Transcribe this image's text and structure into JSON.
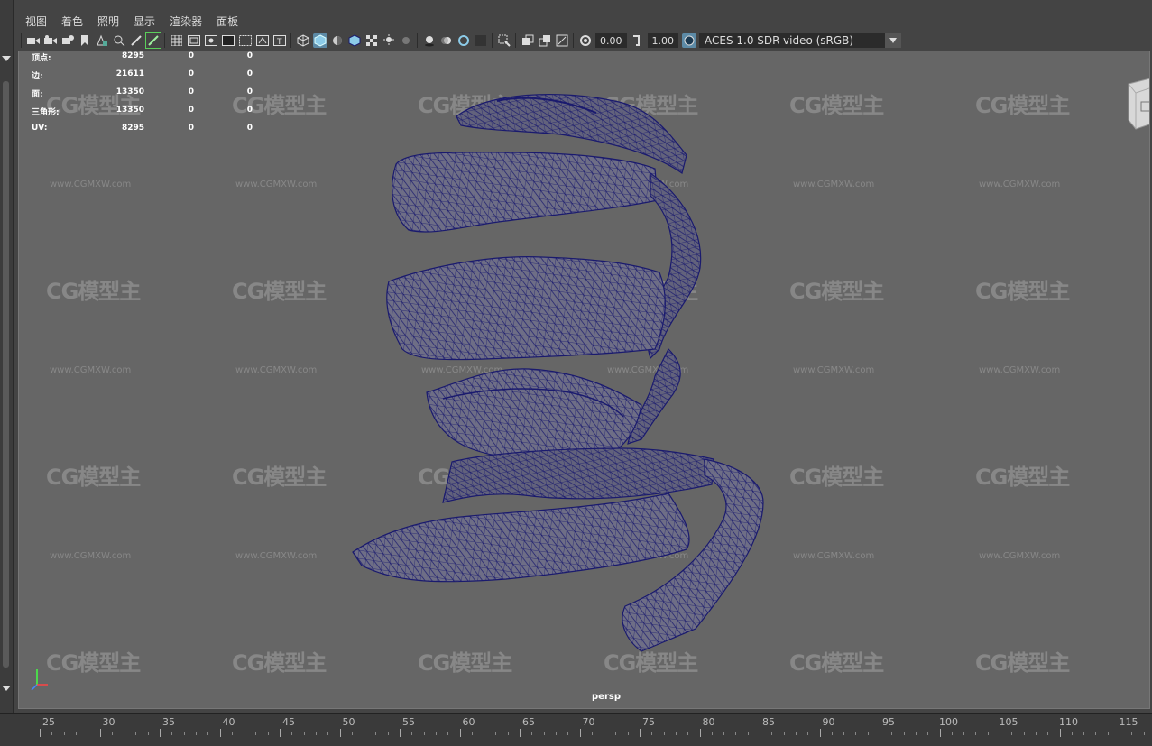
{
  "menu": [
    "视图",
    "着色",
    "照明",
    "显示",
    "渲染器",
    "面板"
  ],
  "toolbar": {
    "gamma_value": "0.00",
    "exposure_value": "1.00",
    "color_space": "ACES 1.0 SDR-video (sRGB)"
  },
  "hud": {
    "rows": [
      {
        "label": "顶点:",
        "v1": "8295",
        "v2": "0",
        "v3": "0"
      },
      {
        "label": "边:",
        "v1": "21611",
        "v2": "0",
        "v3": "0"
      },
      {
        "label": "面:",
        "v1": "13350",
        "v2": "0",
        "v3": "0"
      },
      {
        "label": "三角形:",
        "v1": "13350",
        "v2": "0",
        "v3": "0"
      },
      {
        "label": "UV:",
        "v1": "8295",
        "v2": "0",
        "v3": "0"
      }
    ]
  },
  "viewport": {
    "camera": "persp",
    "mesh_color": "#1a1a6e",
    "background_color": "#666666"
  },
  "timeline": {
    "labels": [
      "25",
      "30",
      "35",
      "40",
      "45",
      "50",
      "55",
      "60",
      "65",
      "70",
      "75",
      "80",
      "85",
      "90",
      "95",
      "100",
      "105",
      "110",
      "115"
    ]
  },
  "watermark": {
    "logo": "CG模型主",
    "url": "www.CGMXW.com"
  }
}
